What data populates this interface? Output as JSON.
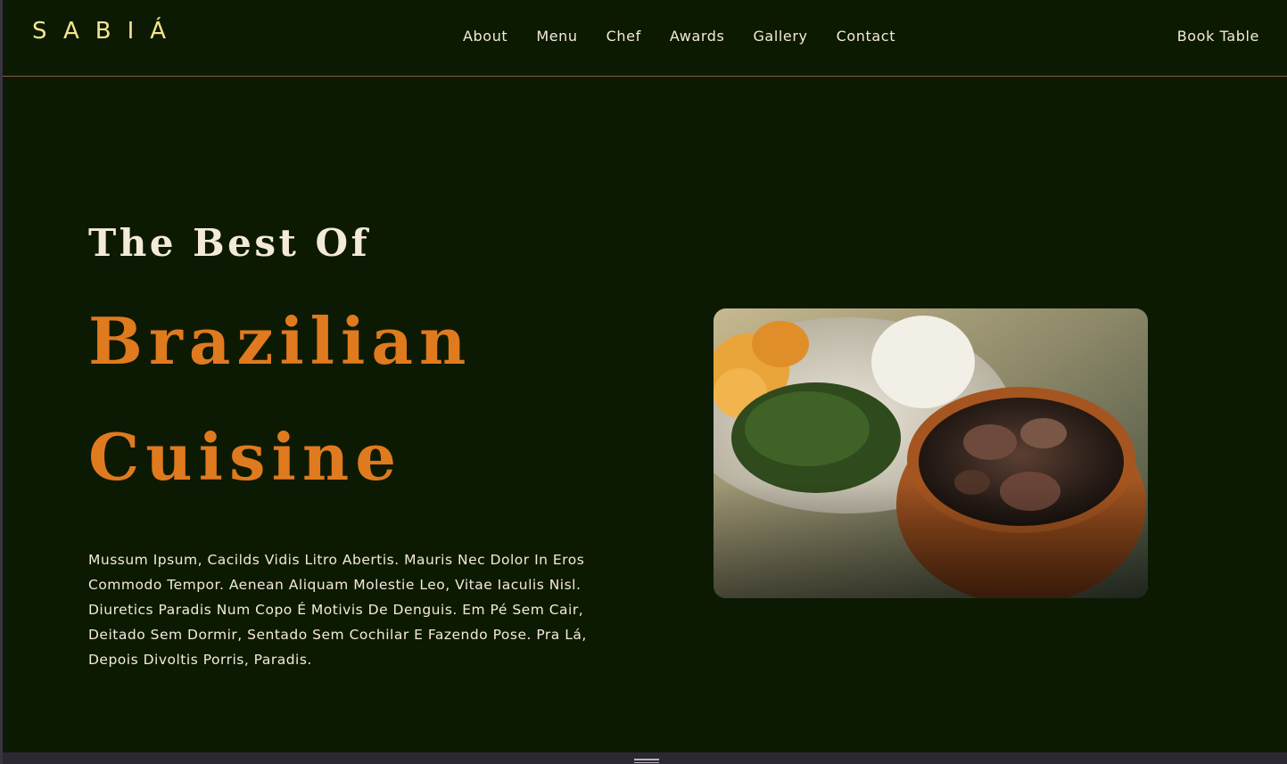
{
  "brand": {
    "logo_text": "SABIÁ",
    "color": "#f6e48e"
  },
  "nav": {
    "items": [
      {
        "label": "About"
      },
      {
        "label": "Menu"
      },
      {
        "label": "Chef"
      },
      {
        "label": "Awards"
      },
      {
        "label": "Gallery"
      },
      {
        "label": "Contact"
      }
    ],
    "cta_label": "Book Table"
  },
  "hero": {
    "kicker": "The Best Of",
    "title_line1": "Brazilian",
    "title_line2": "Cuisine",
    "accent_color": "#e07a1e",
    "body": "Mussum Ipsum, Cacilds Vidis Litro Abertis. Mauris Nec Dolor In Eros Commodo Tempor. Aenean Aliquam Molestie Leo, Vitae Iaculis Nisl. Diuretics Paradis Num Copo É Motivis De Denguis. Em Pé Sem Cair, Deitado Sem Dormir, Sentado Sem Cochilar E Fazendo Pose. Pra Lá, Depois Divoltis Porris, Paradis.",
    "image_subject": "feijoada-dish-photo"
  },
  "theme": {
    "background": "#0d1a03",
    "text": "#f3ead7",
    "divider": "#8a5a48"
  }
}
